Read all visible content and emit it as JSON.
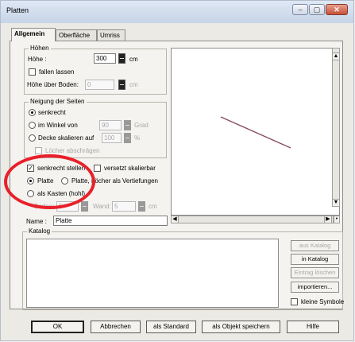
{
  "window": {
    "title": "Platten",
    "controls": {
      "minimize": "–",
      "maximize": "▢",
      "close": "✕"
    }
  },
  "tabs": [
    {
      "label": "Allgemein",
      "active": true
    },
    {
      "label": "Oberfläche",
      "active": false
    },
    {
      "label": "Umriss",
      "active": false
    }
  ],
  "hoehen": {
    "legend": "Höhen",
    "hoehe_label": "Höhe :",
    "hoehe_value": "300",
    "hoehe_unit": "cm",
    "fallen_lassen": "fallen lassen",
    "hoehe_ueber_boden_label": "Höhe über Boden:",
    "hoehe_ueber_boden_value": "0",
    "hoehe_ueber_boden_unit": "cm"
  },
  "neigung": {
    "legend": "Neigung der Seiten",
    "senkrecht": "senkrecht",
    "im_winkel_von": "im Winkel von",
    "winkel_value": "90",
    "winkel_unit": "Grad",
    "decke_skalieren_auf": "Decke skalieren auf",
    "decke_value": "100",
    "decke_unit": "%",
    "loecher_abschraegen": "Löcher abschrägen"
  },
  "options": {
    "senkrecht_stellen": "senkrecht stellen",
    "versetzt_skalierbar": "versetzt skalierbar",
    "platte": "Platte",
    "platte_loecher": "Platte, Löcher als Vertiefungen",
    "als_kasten": "als Kasten (hohl)",
    "boden_label": "Boden:",
    "boden_value": "5",
    "wand_label": "Wand:",
    "wand_value": "5",
    "unit_cm": "cm"
  },
  "name": {
    "label": "Name :",
    "value": "Platte"
  },
  "katalog": {
    "legend": "Katalog",
    "buttons": {
      "aus_katalog": "aus Katalog",
      "in_katalog": "in Katalog",
      "eintrag_loeschen": "Eintrag löschen",
      "importieren": "importieren..."
    },
    "kleine_symbole": "kleine Symbole"
  },
  "footer": {
    "ok": "OK",
    "abbrechen": "Abbrechen",
    "als_standard": "als Standard",
    "als_objekt_speichern": "als Objekt speichern",
    "hilfe": "Hilfe"
  },
  "colors": {
    "annotation": "#e8202a",
    "titlebar": "#c6d4e8",
    "dialog_bg": "#eceae4"
  }
}
